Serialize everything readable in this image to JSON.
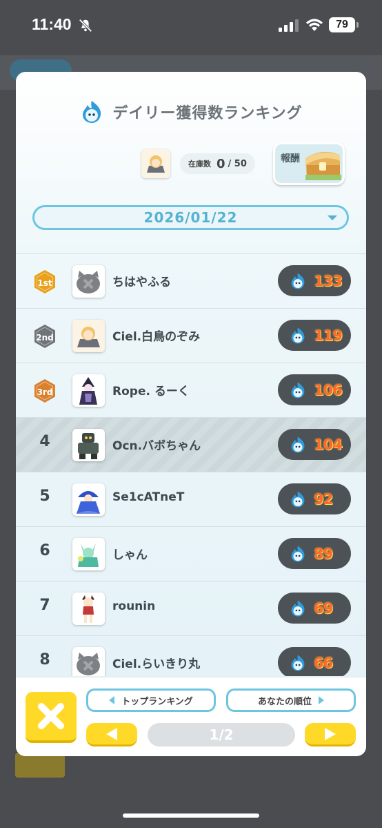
{
  "status": {
    "time": "11:40",
    "battery": "79"
  },
  "header": {
    "title": "デイリー獲得数ランキング"
  },
  "stock": {
    "label": "在庫数",
    "value": "0",
    "max": "/ 50"
  },
  "reward": {
    "label": "報酬"
  },
  "date": {
    "selected": "2026/01/22"
  },
  "ranking": [
    {
      "rank": "1",
      "badge": "1st",
      "name": "ちはやふる",
      "score": "133",
      "avatar": "gray-cat"
    },
    {
      "rank": "2",
      "badge": "2nd",
      "name": "Ciel.白鳥のぞみ",
      "score": "119",
      "avatar": "cat-girl"
    },
    {
      "rank": "3",
      "badge": "3rd",
      "name": "Rope. るーく",
      "score": "106",
      "avatar": "dark-witch"
    },
    {
      "rank": "4",
      "name": "Ocn.バボちゃん",
      "score": "104",
      "avatar": "robot",
      "is_me": true
    },
    {
      "rank": "5",
      "name": "Se1cATneT",
      "score": "92",
      "avatar": "blue-mage"
    },
    {
      "rank": "6",
      "name": "しゃん",
      "score": "89",
      "avatar": "green-fox"
    },
    {
      "rank": "7",
      "name": "rounin",
      "score": "69",
      "avatar": "red-girl"
    },
    {
      "rank": "8",
      "name": "Ciel.らいきり丸",
      "score": "66",
      "avatar": "gray-cat"
    }
  ],
  "footer": {
    "top_ranking": "トップランキング",
    "my_rank": "あなたの順位",
    "page": "1/2"
  },
  "colors": {
    "accent": "#6cc6e0",
    "score_text": "#ff6a2a",
    "button_yellow": "#ffd928",
    "medal_gold": "#e9a11a",
    "medal_silver": "#6f7478",
    "medal_bronze": "#d9812f"
  }
}
